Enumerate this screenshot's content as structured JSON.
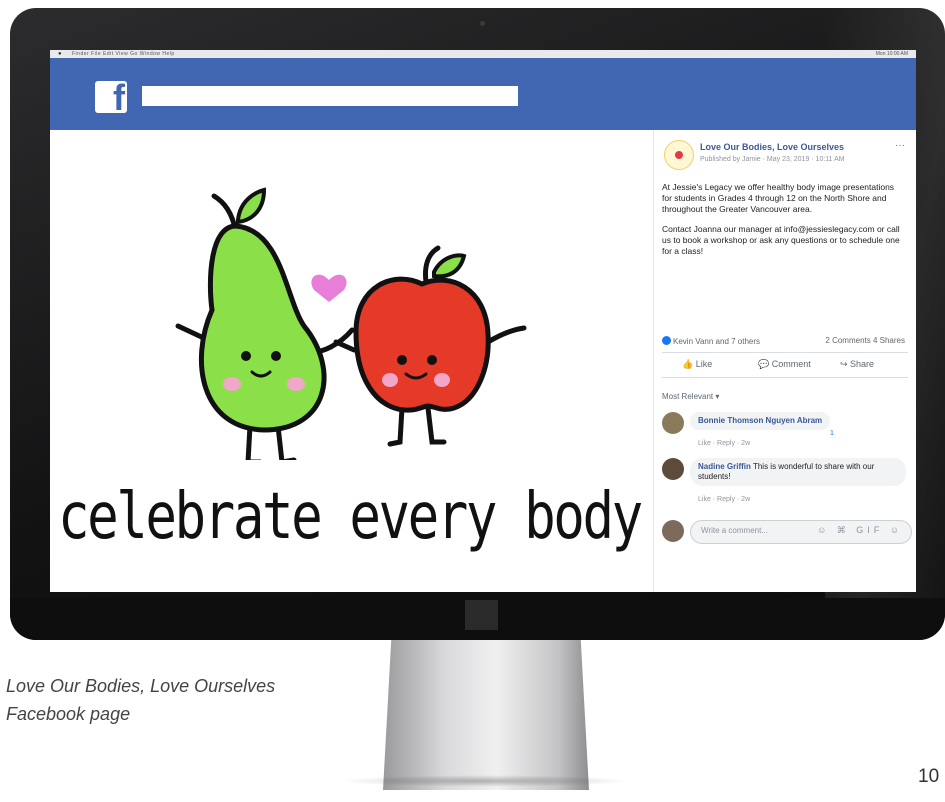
{
  "menubar": {
    "apple": "",
    "items": "Finder  File  Edit  View  Go  Window  Help",
    "right": "Mon 10:00 AM"
  },
  "facebook": {
    "logo": "f",
    "search_placeholder": ""
  },
  "post": {
    "caption": "celebrate every body.",
    "page_name": "Love Our Bodies, Love Ourselves",
    "meta": "Published by Jamie · May 23, 2019 · 10:11 AM",
    "more": "···",
    "paragraph1": "At Jessie's Legacy we offer healthy body image presentations for students in Grades 4 through 12 on the North Shore and throughout the Greater Vancouver area.",
    "paragraph2": "Contact Joanna our manager at info@jessieslegacy.com or call us to book a workshop or ask any questions or to schedule one for a class!",
    "reactions": "Kevin Vann and 7 others",
    "counts": "2 Comments  4 Shares",
    "actions": {
      "like": "Like",
      "comment": "Comment",
      "share": "Share"
    },
    "most_relevant": "Most Relevant ▾",
    "comments": [
      {
        "name": "Bonnie Thomson Nguyen Abram",
        "text": "",
        "actions": "Like · Reply · 2w",
        "reaction_count": "1"
      },
      {
        "name": "Nadine Griffin",
        "text": "This is wonderful to share with our students!",
        "actions": "Like · Reply · 2w"
      }
    ],
    "write_placeholder": "Write a comment...",
    "write_icons": "☺ ⌘ GIF ☺"
  },
  "figure_caption": {
    "line1": "Love Our Bodies, Love Ourselves",
    "line2": "Facebook page"
  },
  "page_number": "10",
  "colors": {
    "facebook_blue": "#4267b2",
    "pear_green": "#8be04a",
    "apple_red": "#e63a28",
    "heart_pink": "#e77fd8"
  }
}
